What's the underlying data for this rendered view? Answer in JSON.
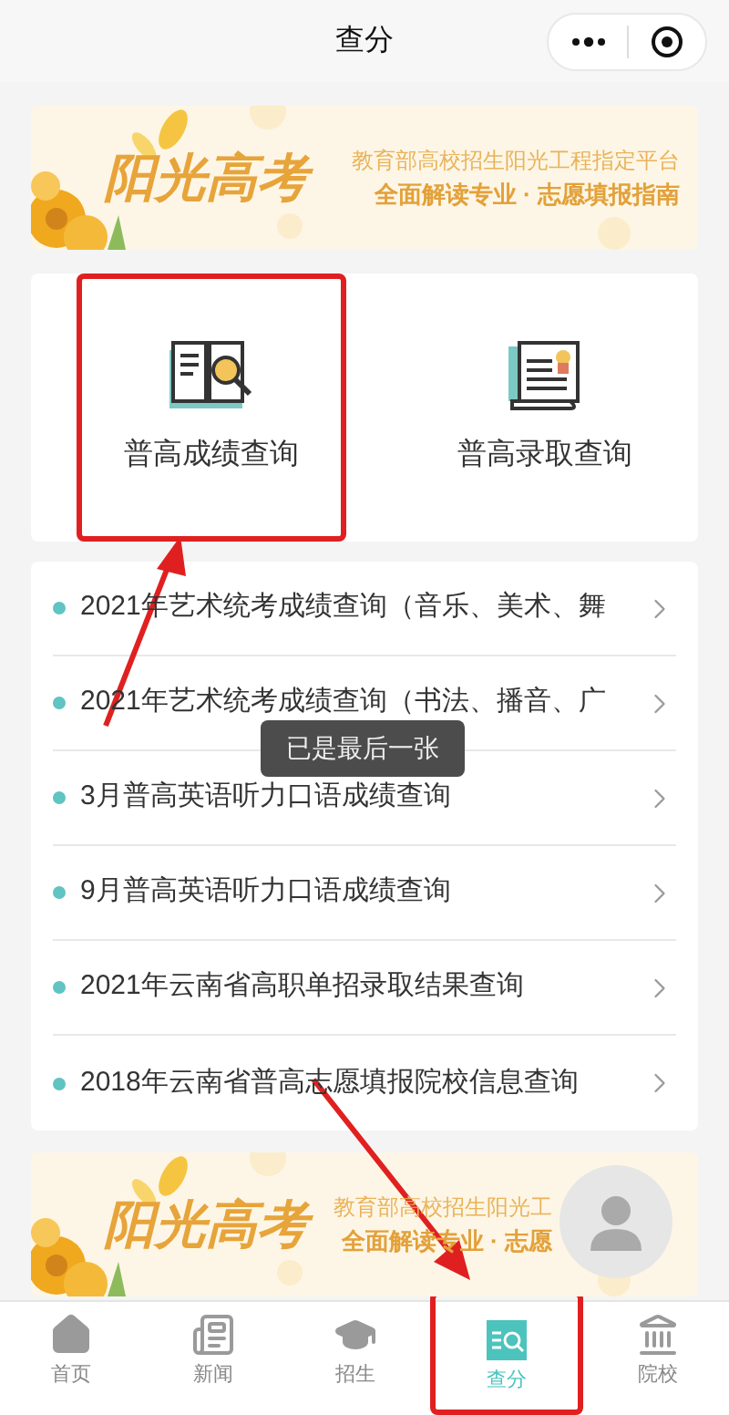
{
  "header": {
    "title": "查分"
  },
  "banners": [
    {
      "logo": "阳光高考",
      "line_1": "教育部高校招生阳光工程指定平台",
      "line_2": "全面解读专业 · 志愿填报指南"
    },
    {
      "logo": "阳光高考",
      "line_1": "教育部高校招生阳光工",
      "line_2": "全面解读专业 · 志愿"
    }
  ],
  "entries": [
    {
      "kind": "book",
      "label": "普高成绩查询",
      "highlighted": true
    },
    {
      "kind": "certificate",
      "label": "普高录取查询",
      "highlighted": false
    }
  ],
  "list": [
    {
      "label": "2021年艺术统考成绩查询（音乐、美术、舞"
    },
    {
      "label": "2021年艺术统考成绩查询（书法、播音、广"
    },
    {
      "label": "3月普高英语听力口语成绩查询"
    },
    {
      "label": "9月普高英语听力口语成绩查询"
    },
    {
      "label": "2021年云南省高职单招录取结果查询"
    },
    {
      "label": "2018年云南省普高志愿填报院校信息查询"
    }
  ],
  "toast": "已是最后一张",
  "tabs": [
    {
      "kind": "home",
      "label": "首页",
      "selected": false,
      "highlighted": false
    },
    {
      "kind": "news",
      "label": "新闻",
      "selected": false,
      "highlighted": false
    },
    {
      "kind": "cap",
      "label": "招生",
      "selected": false,
      "highlighted": false
    },
    {
      "kind": "query",
      "label": "查分",
      "selected": true,
      "highlighted": true
    },
    {
      "kind": "bank",
      "label": "院校",
      "selected": false,
      "highlighted": false
    }
  ]
}
